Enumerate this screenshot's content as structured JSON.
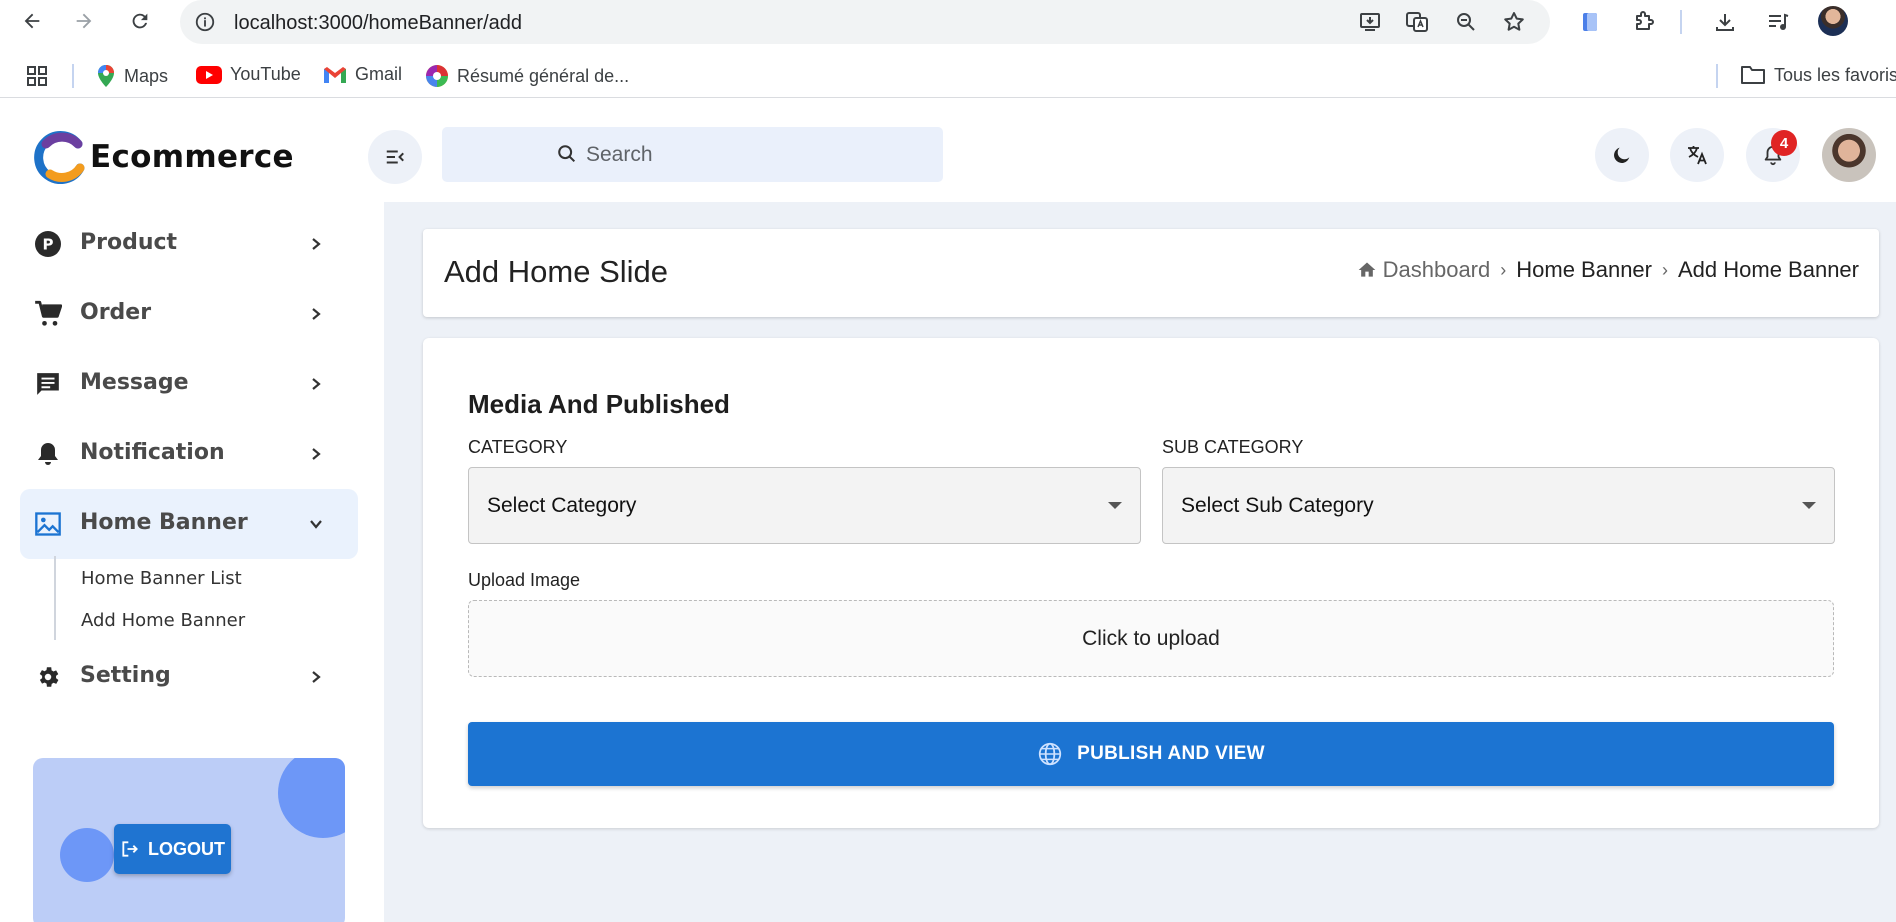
{
  "browser": {
    "url": "localhost:3000/homeBanner/add",
    "bookmarks": [
      {
        "label": "Maps",
        "icon": "maps-icon"
      },
      {
        "label": "YouTube",
        "icon": "youtube-icon"
      },
      {
        "label": "Gmail",
        "icon": "gmail-icon"
      },
      {
        "label": "Résumé général de...",
        "icon": "color-wheel-icon"
      }
    ],
    "all_bookmarks_label": "Tous les favoris"
  },
  "app": {
    "logo_text": "Ecommerce",
    "search_placeholder": "Search",
    "notification_count": "4",
    "colors": {
      "primary": "#1c74d2",
      "sidebar_active": "#eaf2fd",
      "main_bg": "#edf1f7",
      "badge": "#e02424"
    }
  },
  "sidebar": {
    "items": [
      {
        "label": "Product",
        "icon": "product-p-icon"
      },
      {
        "label": "Order",
        "icon": "cart-icon"
      },
      {
        "label": "Message",
        "icon": "message-icon"
      },
      {
        "label": "Notification",
        "icon": "bell-icon"
      },
      {
        "label": "Home Banner",
        "icon": "image-icon",
        "expanded": true
      },
      {
        "label": "Setting",
        "icon": "gear-icon"
      }
    ],
    "sub_items": [
      {
        "label": "Home Banner List"
      },
      {
        "label": "Add Home Banner"
      }
    ],
    "logout_label": "LOGOUT"
  },
  "page": {
    "title": "Add Home Slide",
    "breadcrumb": [
      "Dashboard",
      "Home Banner",
      "Add Home Banner"
    ]
  },
  "form": {
    "section_title": "Media And Published",
    "category_label": "CATEGORY",
    "category_value": "Select Category",
    "subcategory_label": "SUB CATEGORY",
    "subcategory_value": "Select Sub Category",
    "upload_label": "Upload Image",
    "upload_text": "Click to upload",
    "publish_label": "PUBLISH AND VIEW"
  }
}
